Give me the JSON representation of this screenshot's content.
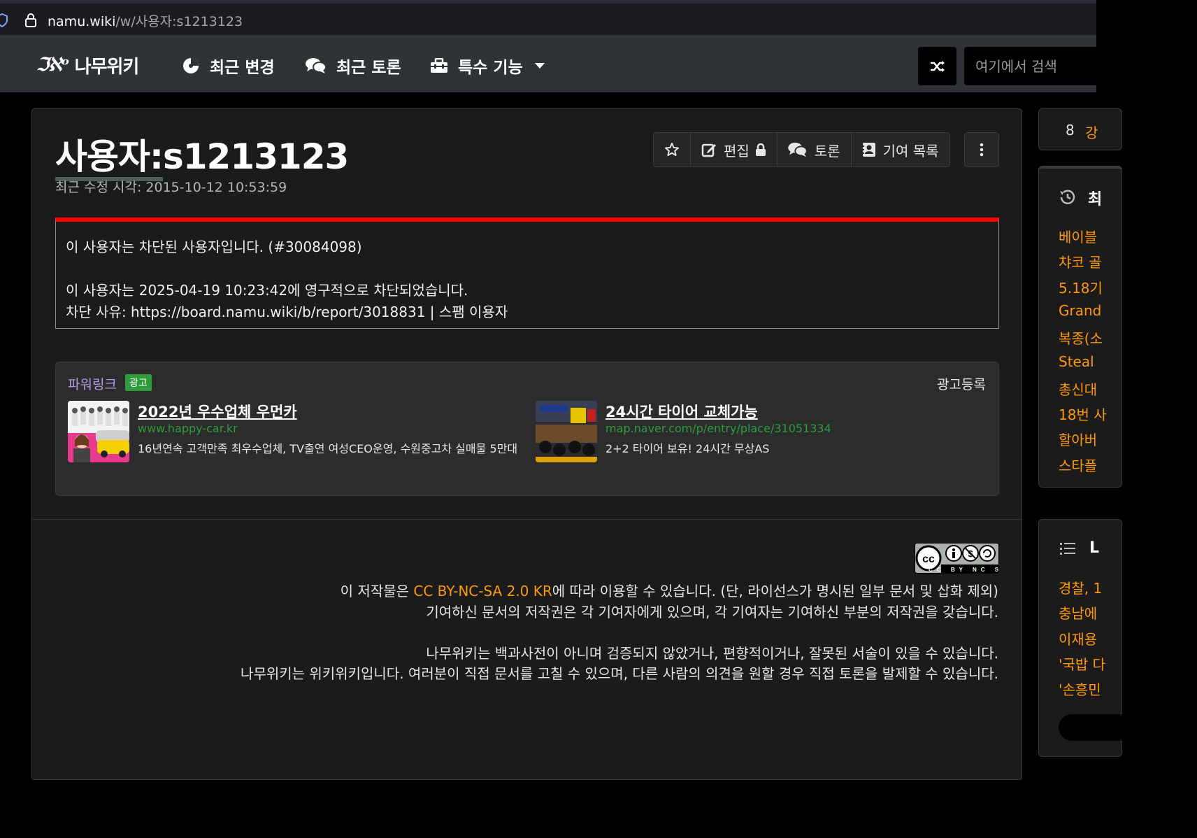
{
  "browser": {
    "url_host": "namu.wiki",
    "url_path": "/w/사용자:s1213123"
  },
  "nav": {
    "logo_mark": "ℑℵᵒ",
    "logo_text": "나무위키",
    "recent_changes": "최근 변경",
    "recent_discuss": "최근 토론",
    "special": "특수 기능",
    "search_placeholder": "여기에서 검색"
  },
  "article": {
    "title_ns": "사용자:",
    "title_name": "s1213123",
    "last_modified": "최근 수정 시각: 2015-10-12 10:53:59",
    "toolbar": {
      "edit": "편집",
      "discuss": "토론",
      "contributions": "기여 목록"
    },
    "block_notice": {
      "line1": "이 사용자는 차단된 사용자입니다. (#30084098)",
      "line2": "이 사용자는 2025-04-19 10:23:42에 영구적으로 차단되었습니다.",
      "line3": "차단 사유: https://board.namu.wiki/b/report/3018831 | 스팸 이용자"
    }
  },
  "ads": {
    "powerlink": "파워링크",
    "ad_tag": "광고",
    "register": "광고등록",
    "items": [
      {
        "title": "2022년 우수업체 우먼카",
        "url": "www.happy-car.kr",
        "desc": "16년연속 고객만족 최우수업체, TV출연 여성CEO운영, 수원중고차 실매물 5만대"
      },
      {
        "title": "24시간 타이어 교체가능",
        "url": "map.naver.com/p/entry/place/31051334",
        "desc": "2+2 타이어 보유! 24시간 무상AS"
      }
    ]
  },
  "footer": {
    "cc_badge": "CC BY NC SA",
    "license_pre": "이 저작물은 ",
    "license_link": "CC BY-NC-SA 2.0 KR",
    "license_post": "에 따라 이용할 수 있습니다. (단, 라이선스가 명시된 일부 문서 및 삽화 제외)",
    "line2": "기여하신 문서의 저작권은 각 기여자에게 있으며, 각 기여자는 기여하신 부분의 저작권을 갖습니다.",
    "line3": "나무위키는 백과사전이 아니며 검증되지 않았거나, 편향적이거나, 잘못된 서술이 있을 수 있습니다.",
    "line4": "나무위키는 위키위키입니다. 여러분이 직접 문서를 고칠 수 있으며, 다른 사람의 의견을 원할 경우 직접 토론을 발제할 수 있습니다."
  },
  "sidebar": {
    "rank_number": "8",
    "rank_text": "강",
    "recent_head": "최",
    "recent_items": [
      "베이블",
      "챠코 골",
      "5.18기",
      "Grand",
      "복종(소",
      "Steal",
      "총신대",
      "18번 사",
      "할아버",
      "스타플"
    ],
    "news_head": "L",
    "news_items": [
      "경찰, 1",
      "충남에",
      "이재용",
      "'국밥 다",
      "'손흥민"
    ]
  },
  "colors": {
    "accent_orange": "#ff9900",
    "block_red": "#ff0000",
    "ad_green": "#2e9b3c",
    "powerlink_purple": "#b399e6",
    "nav_bg": "#2f3237"
  }
}
